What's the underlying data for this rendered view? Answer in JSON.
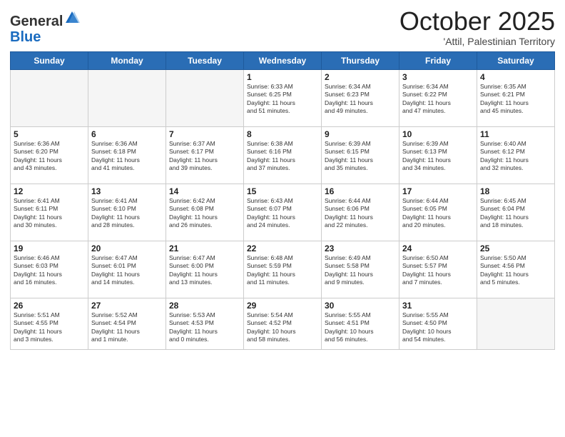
{
  "header": {
    "logo_general": "General",
    "logo_blue": "Blue",
    "month_title": "October 2025",
    "location": "'Attil, Palestinian Territory"
  },
  "days_of_week": [
    "Sunday",
    "Monday",
    "Tuesday",
    "Wednesday",
    "Thursday",
    "Friday",
    "Saturday"
  ],
  "weeks": [
    [
      {
        "day": "",
        "info": ""
      },
      {
        "day": "",
        "info": ""
      },
      {
        "day": "",
        "info": ""
      },
      {
        "day": "1",
        "info": "Sunrise: 6:33 AM\nSunset: 6:25 PM\nDaylight: 11 hours\nand 51 minutes."
      },
      {
        "day": "2",
        "info": "Sunrise: 6:34 AM\nSunset: 6:23 PM\nDaylight: 11 hours\nand 49 minutes."
      },
      {
        "day": "3",
        "info": "Sunrise: 6:34 AM\nSunset: 6:22 PM\nDaylight: 11 hours\nand 47 minutes."
      },
      {
        "day": "4",
        "info": "Sunrise: 6:35 AM\nSunset: 6:21 PM\nDaylight: 11 hours\nand 45 minutes."
      }
    ],
    [
      {
        "day": "5",
        "info": "Sunrise: 6:36 AM\nSunset: 6:20 PM\nDaylight: 11 hours\nand 43 minutes."
      },
      {
        "day": "6",
        "info": "Sunrise: 6:36 AM\nSunset: 6:18 PM\nDaylight: 11 hours\nand 41 minutes."
      },
      {
        "day": "7",
        "info": "Sunrise: 6:37 AM\nSunset: 6:17 PM\nDaylight: 11 hours\nand 39 minutes."
      },
      {
        "day": "8",
        "info": "Sunrise: 6:38 AM\nSunset: 6:16 PM\nDaylight: 11 hours\nand 37 minutes."
      },
      {
        "day": "9",
        "info": "Sunrise: 6:39 AM\nSunset: 6:15 PM\nDaylight: 11 hours\nand 35 minutes."
      },
      {
        "day": "10",
        "info": "Sunrise: 6:39 AM\nSunset: 6:13 PM\nDaylight: 11 hours\nand 34 minutes."
      },
      {
        "day": "11",
        "info": "Sunrise: 6:40 AM\nSunset: 6:12 PM\nDaylight: 11 hours\nand 32 minutes."
      }
    ],
    [
      {
        "day": "12",
        "info": "Sunrise: 6:41 AM\nSunset: 6:11 PM\nDaylight: 11 hours\nand 30 minutes."
      },
      {
        "day": "13",
        "info": "Sunrise: 6:41 AM\nSunset: 6:10 PM\nDaylight: 11 hours\nand 28 minutes."
      },
      {
        "day": "14",
        "info": "Sunrise: 6:42 AM\nSunset: 6:08 PM\nDaylight: 11 hours\nand 26 minutes."
      },
      {
        "day": "15",
        "info": "Sunrise: 6:43 AM\nSunset: 6:07 PM\nDaylight: 11 hours\nand 24 minutes."
      },
      {
        "day": "16",
        "info": "Sunrise: 6:44 AM\nSunset: 6:06 PM\nDaylight: 11 hours\nand 22 minutes."
      },
      {
        "day": "17",
        "info": "Sunrise: 6:44 AM\nSunset: 6:05 PM\nDaylight: 11 hours\nand 20 minutes."
      },
      {
        "day": "18",
        "info": "Sunrise: 6:45 AM\nSunset: 6:04 PM\nDaylight: 11 hours\nand 18 minutes."
      }
    ],
    [
      {
        "day": "19",
        "info": "Sunrise: 6:46 AM\nSunset: 6:03 PM\nDaylight: 11 hours\nand 16 minutes."
      },
      {
        "day": "20",
        "info": "Sunrise: 6:47 AM\nSunset: 6:01 PM\nDaylight: 11 hours\nand 14 minutes."
      },
      {
        "day": "21",
        "info": "Sunrise: 6:47 AM\nSunset: 6:00 PM\nDaylight: 11 hours\nand 13 minutes."
      },
      {
        "day": "22",
        "info": "Sunrise: 6:48 AM\nSunset: 5:59 PM\nDaylight: 11 hours\nand 11 minutes."
      },
      {
        "day": "23",
        "info": "Sunrise: 6:49 AM\nSunset: 5:58 PM\nDaylight: 11 hours\nand 9 minutes."
      },
      {
        "day": "24",
        "info": "Sunrise: 6:50 AM\nSunset: 5:57 PM\nDaylight: 11 hours\nand 7 minutes."
      },
      {
        "day": "25",
        "info": "Sunrise: 5:50 AM\nSunset: 4:56 PM\nDaylight: 11 hours\nand 5 minutes."
      }
    ],
    [
      {
        "day": "26",
        "info": "Sunrise: 5:51 AM\nSunset: 4:55 PM\nDaylight: 11 hours\nand 3 minutes."
      },
      {
        "day": "27",
        "info": "Sunrise: 5:52 AM\nSunset: 4:54 PM\nDaylight: 11 hours\nand 1 minute."
      },
      {
        "day": "28",
        "info": "Sunrise: 5:53 AM\nSunset: 4:53 PM\nDaylight: 11 hours\nand 0 minutes."
      },
      {
        "day": "29",
        "info": "Sunrise: 5:54 AM\nSunset: 4:52 PM\nDaylight: 10 hours\nand 58 minutes."
      },
      {
        "day": "30",
        "info": "Sunrise: 5:55 AM\nSunset: 4:51 PM\nDaylight: 10 hours\nand 56 minutes."
      },
      {
        "day": "31",
        "info": "Sunrise: 5:55 AM\nSunset: 4:50 PM\nDaylight: 10 hours\nand 54 minutes."
      },
      {
        "day": "",
        "info": ""
      }
    ]
  ]
}
